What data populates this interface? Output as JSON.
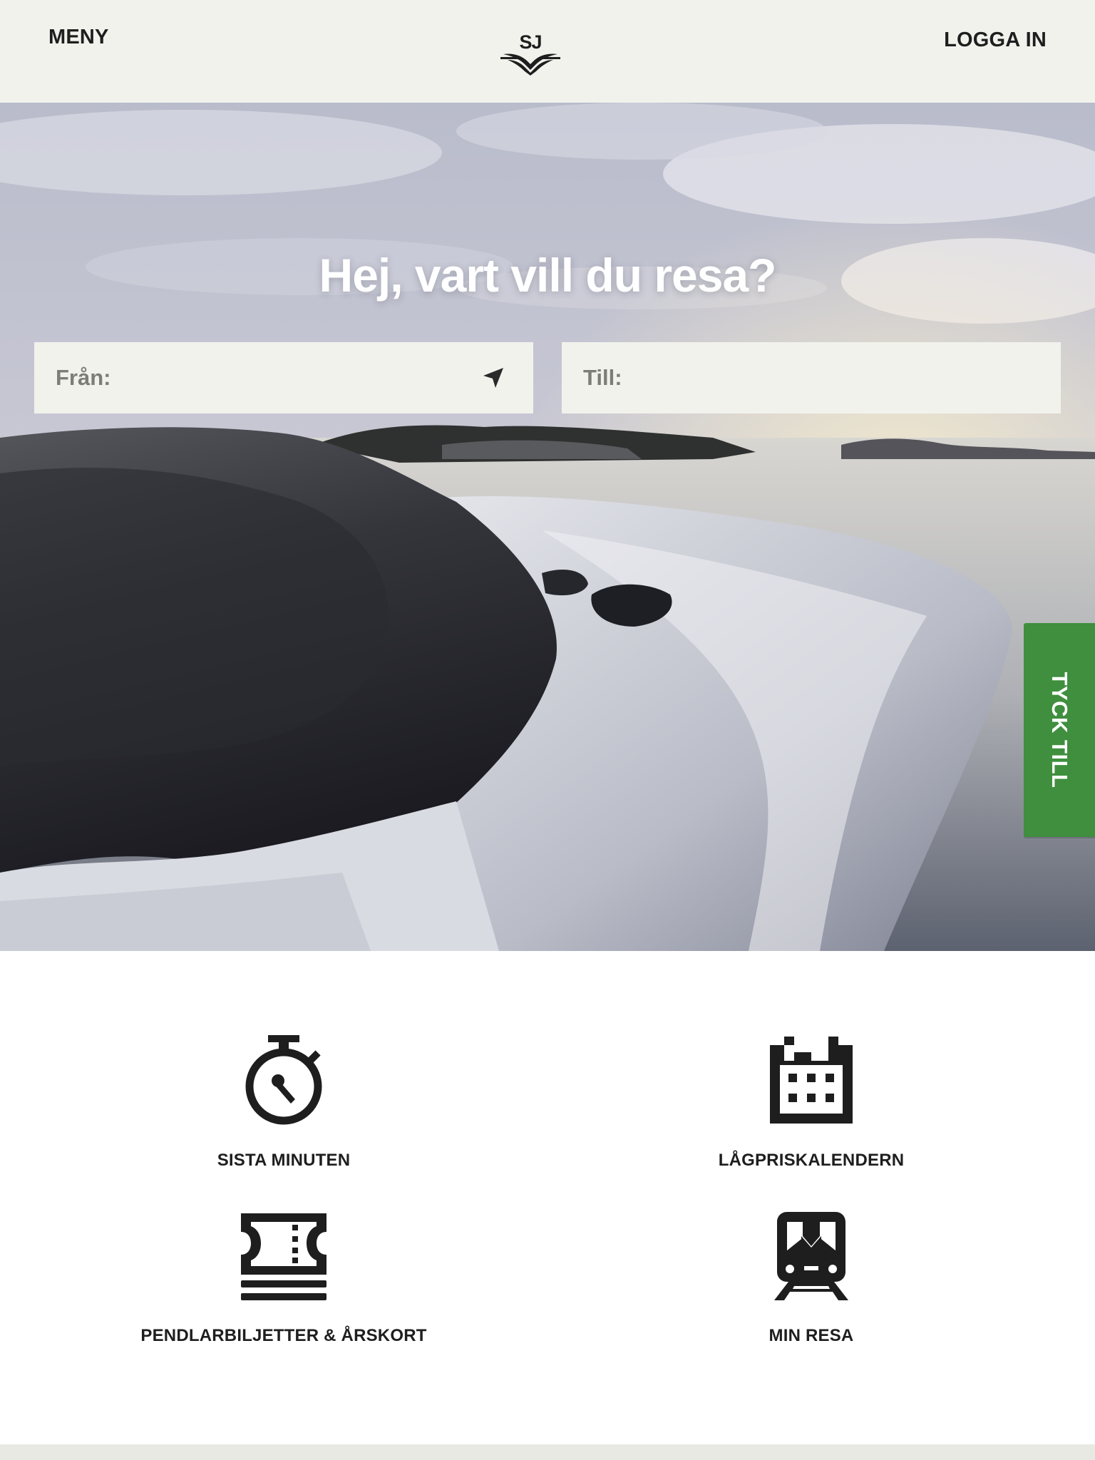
{
  "header": {
    "menu_label": "MENY",
    "login_label": "LOGGA IN",
    "logo_text": "SJ"
  },
  "hero": {
    "title": "Hej, vart vill du resa?",
    "from_placeholder": "Från:",
    "to_placeholder": "Till:",
    "feedback_label": "TYCK TILL"
  },
  "shortcuts": [
    {
      "label": "SISTA MINUTEN",
      "icon": "stopwatch-icon"
    },
    {
      "label": "LÅGPRISKALENDERN",
      "icon": "calendar-icon"
    },
    {
      "label": "PENDLARBILJETTER & ÅRSKORT",
      "icon": "ticket-icon"
    },
    {
      "label": "MIN RESA",
      "icon": "train-icon"
    }
  ],
  "colors": {
    "header_bg": "#f2f2ed",
    "feedback_green": "#3f8f3e",
    "text_dark": "#1e1e1e"
  }
}
